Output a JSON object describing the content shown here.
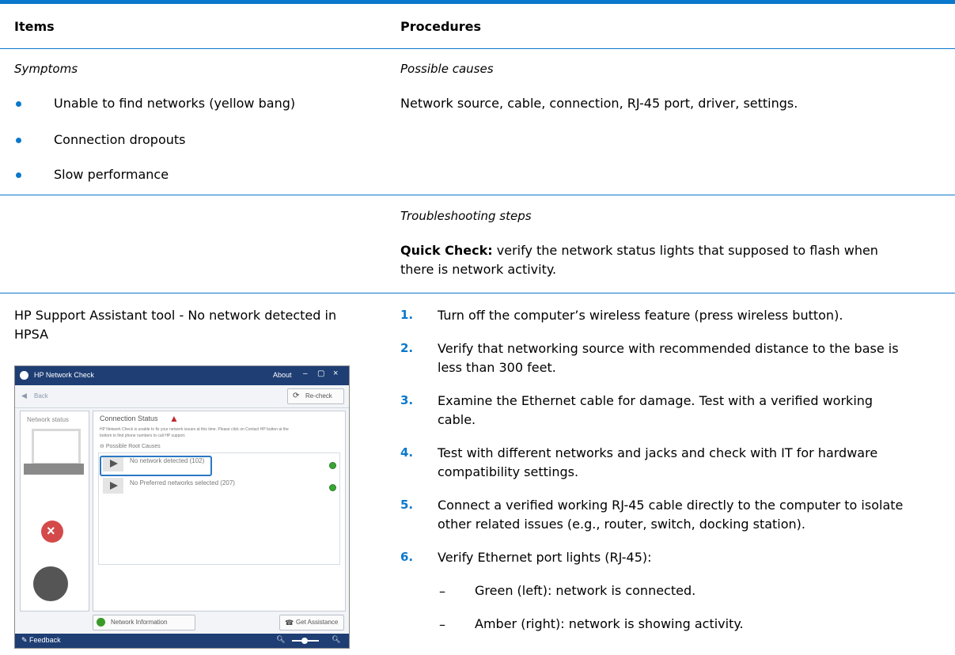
{
  "header": {
    "items": "Items",
    "procedures": "Procedures"
  },
  "row1": {
    "symptoms_label": "Symptoms",
    "symptoms": [
      "Unable to find networks (yellow bang)",
      "Connection dropouts",
      "Slow performance"
    ],
    "causes_label": "Possible causes",
    "causes_text": "Network source, cable, connection, RJ-45 port, driver, settings."
  },
  "row2": {
    "steps_label": "Troubleshooting steps",
    "quick_check_bold": "Quick Check:",
    "quick_check_line1": " verify the network status lights that supposed to flash when",
    "quick_check_line2": "there is network activity."
  },
  "row3": {
    "tool_line1": "HP Support Assistant tool - No network detected in",
    "tool_line2": "HPSA",
    "steps": [
      {
        "num": "1.",
        "lines": [
          "Turn off the computer’s wireless feature (press wireless button)."
        ]
      },
      {
        "num": "2.",
        "lines": [
          "Verify that networking source with recommended distance to the base is",
          "less than 300 feet."
        ]
      },
      {
        "num": "3.",
        "lines": [
          "Examine the Ethernet cable for damage. Test with a verified working",
          "cable."
        ]
      },
      {
        "num": "4.",
        "lines": [
          "Test with different networks and jacks and check with IT for hardware",
          "compatibility settings."
        ]
      },
      {
        "num": "5.",
        "lines": [
          "Connect a verified working RJ-45 cable directly to the computer to isolate",
          "other related issues (e.g., router, switch, docking station)."
        ]
      },
      {
        "num": "6.",
        "lines": [
          "Verify Ethernet port lights (RJ-45):"
        ]
      }
    ],
    "sub_items": [
      "Green (left): network is connected.",
      "Amber (right): network is showing activity."
    ]
  },
  "screenshot": {
    "title": "HP Network Check",
    "about": "About",
    "back": "Back",
    "recheck": "Re-check",
    "network_status": "Network status",
    "connection_status": "Connection Status",
    "desc1": "HP Network Check is unable to fix your network issues at this time. Please click on Contact HP button at the",
    "desc2": "bottom to find phone numbers to call HP support.",
    "possible_root_causes": "Possible Root Causes",
    "cause1": "No network detected (102)",
    "cause2": "No Preferred networks selected (207)",
    "network_information": "Network Information",
    "get_assistance": "Get Assistance",
    "feedback": "Feedback",
    "colors": {
      "accent": "#0a78cc",
      "titlebar": "#1e3e74"
    }
  }
}
